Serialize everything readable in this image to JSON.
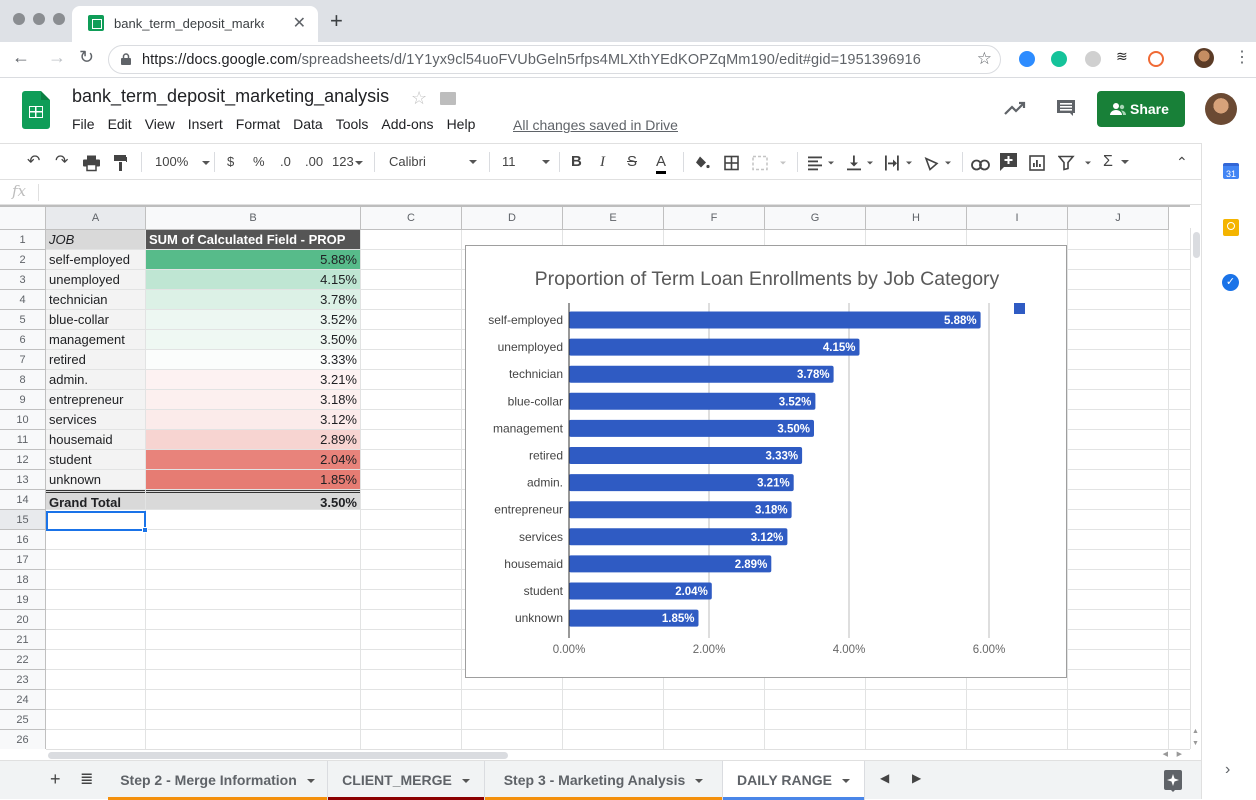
{
  "browser": {
    "tab_title": "bank_term_deposit_marketing_analysis",
    "url_domain": "https://docs.google.com",
    "url_path": "/spreadsheets/d/1Y1yx9cl54uoFVUbGeln5rfps4MLXthYEdKOPZqMm190/edit#gid=1951396916"
  },
  "app": {
    "doc_title": "bank_term_deposit_marketing_analysis",
    "menu": [
      "File",
      "Edit",
      "View",
      "Insert",
      "Format",
      "Data",
      "Tools",
      "Add-ons",
      "Help"
    ],
    "save_status": "All changes saved in Drive",
    "share_label": "Share"
  },
  "toolbar": {
    "zoom": "100%",
    "currency": "$",
    "percent": "%",
    "dec_decrease": ".0",
    "dec_increase": ".00",
    "more_formats": "123",
    "font": "Calibri",
    "font_size": "11",
    "bold": "B",
    "italic": "I",
    "strike": "S",
    "text_color": "A",
    "text_color_value": "#000000"
  },
  "formula_bar": {
    "fx": "fx",
    "value": ""
  },
  "grid": {
    "columns": [
      "A",
      "B",
      "C",
      "D",
      "E",
      "F",
      "G",
      "H",
      "I",
      "J"
    ],
    "rows": [
      "1",
      "2",
      "3",
      "4",
      "5",
      "6",
      "7",
      "8",
      "9",
      "10",
      "11",
      "12",
      "13",
      "14",
      "15",
      "16",
      "17",
      "18",
      "19",
      "20",
      "21",
      "22",
      "23",
      "24",
      "25",
      "26"
    ],
    "selected_cell": "A15",
    "pivot": {
      "header_job": "JOB",
      "header_value": "SUM of Calculated Field - PROP",
      "rows": [
        {
          "job": "self-employed",
          "value": "5.88%",
          "bg": "#57bb8a"
        },
        {
          "job": "unemployed",
          "value": "4.15%",
          "bg": "#bfe6d3"
        },
        {
          "job": "technician",
          "value": "3.78%",
          "bg": "#dcf1e6"
        },
        {
          "job": "blue-collar",
          "value": "3.52%",
          "bg": "#edf7f2"
        },
        {
          "job": "management",
          "value": "3.50%",
          "bg": "#eff8f3"
        },
        {
          "job": "retired",
          "value": "3.33%",
          "bg": "#fbfdfc"
        },
        {
          "job": "admin.",
          "value": "3.21%",
          "bg": "#fdf2f2"
        },
        {
          "job": "entrepreneur",
          "value": "3.18%",
          "bg": "#fcf0ef"
        },
        {
          "job": "services",
          "value": "3.12%",
          "bg": "#fbebea"
        },
        {
          "job": "housemaid",
          "value": "2.89%",
          "bg": "#f7d4d1"
        },
        {
          "job": "student",
          "value": "2.04%",
          "bg": "#e8837b"
        },
        {
          "job": "unknown",
          "value": "1.85%",
          "bg": "#e67c73"
        }
      ],
      "total_label": "Grand Total",
      "total_value": "3.50%"
    }
  },
  "chart_data": {
    "type": "bar",
    "orientation": "horizontal",
    "title": "Proportion of Term Loan Enrollments by Job Category",
    "categories": [
      "self-employed",
      "unemployed",
      "technician",
      "blue-collar",
      "management",
      "retired",
      "admin.",
      "entrepreneur",
      "services",
      "housemaid",
      "student",
      "unknown"
    ],
    "values": [
      5.88,
      4.15,
      3.78,
      3.52,
      3.5,
      3.33,
      3.21,
      3.18,
      3.12,
      2.89,
      2.04,
      1.85
    ],
    "value_labels": [
      "5.88%",
      "4.15%",
      "3.78%",
      "3.52%",
      "3.50%",
      "3.33%",
      "3.21%",
      "3.18%",
      "3.12%",
      "2.89%",
      "2.04%",
      "1.85%"
    ],
    "xlabel": "",
    "ylabel": "",
    "xlim": [
      0,
      6.5
    ],
    "xticks": [
      0,
      2,
      4,
      6
    ],
    "xtick_labels": [
      "0.00%",
      "2.00%",
      "4.00%",
      "6.00%"
    ],
    "grid": true,
    "legend": {
      "position": "right",
      "entries": [
        ""
      ]
    },
    "bar_color": "#2f5bc3"
  },
  "sheet_tabs": [
    {
      "label": "Step 2 - Merge Information",
      "color": "#f4900c",
      "active": false
    },
    {
      "label": "CLIENT_MERGE",
      "color": "#8b0000",
      "active": false
    },
    {
      "label": "Step 3 - Marketing Analysis",
      "color": "#f4900c",
      "active": false
    },
    {
      "label": "DAILY RANGE",
      "color": "#4a86e8",
      "active": true
    }
  ]
}
